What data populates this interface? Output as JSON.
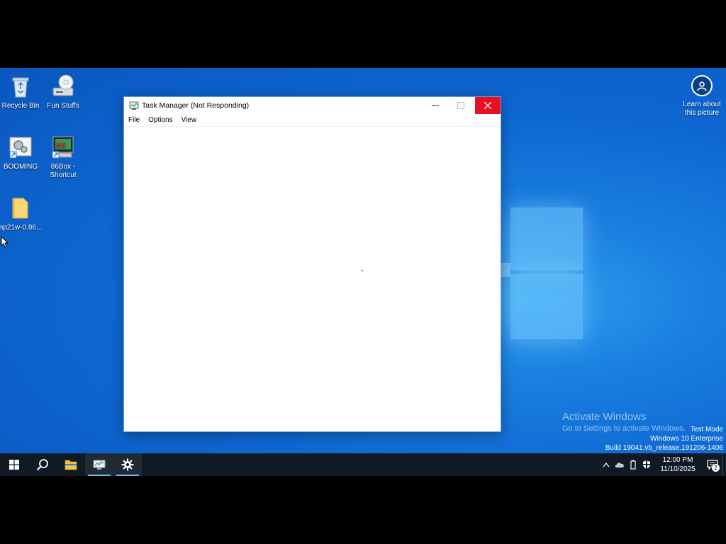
{
  "desktop": {
    "icons": [
      {
        "label": "Recycle Bin",
        "icon": "recycle-bin-icon"
      },
      {
        "label": "Fun Stuffs",
        "icon": "cd-drive-icon"
      },
      {
        "label": "BOOMING",
        "icon": "shortcut-gears-icon"
      },
      {
        "label": "86Box - Shortcut",
        "icon": "86box-icon"
      },
      {
        "label": "np21w-0.86...",
        "icon": "folder-icon"
      }
    ],
    "learn_label": "Learn about this picture",
    "watermark_title": "Activate Windows",
    "watermark_sub": "Go to Settings to activate Windows.",
    "build_lines": [
      "Test Mode",
      "Windows 10 Enterprise",
      "Build 19041.vb_release.191206-1406"
    ]
  },
  "window": {
    "title": "Task Manager (Not Responding)",
    "menu": [
      "File",
      "Options",
      "View"
    ],
    "colors": {
      "close": "#e81123"
    }
  },
  "taskbar": {
    "clock_time": "12:00 PM",
    "clock_date": "11/10/2025",
    "notification_count": "2",
    "colors": {
      "background": "#101a24",
      "accent": "#76b9ed"
    }
  }
}
